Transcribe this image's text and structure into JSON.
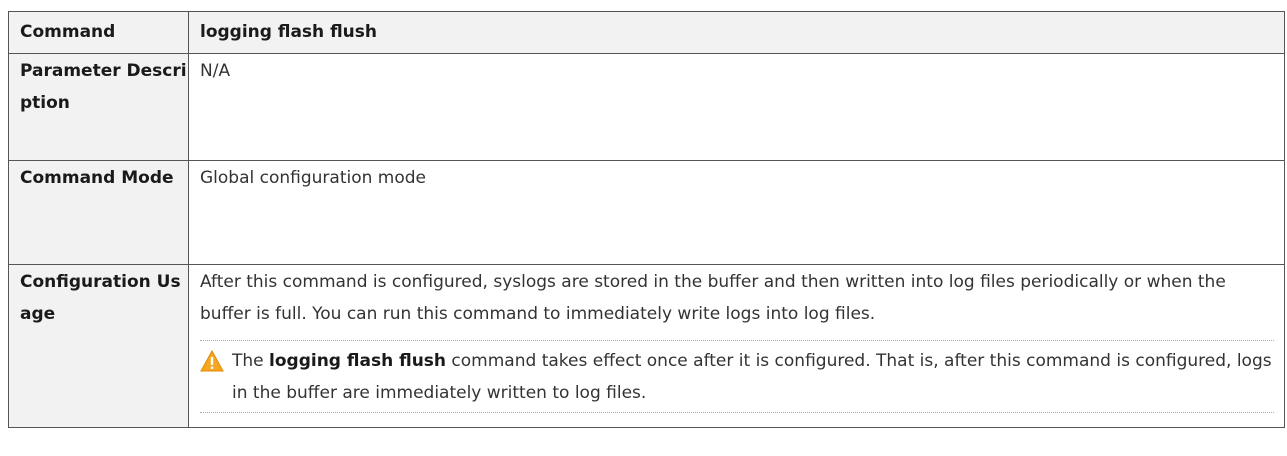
{
  "table": {
    "header": {
      "label": "Command",
      "value": "logging flash flush"
    },
    "parameter": {
      "label": "Parameter Description",
      "value": "N/A"
    },
    "mode": {
      "label": "Command Mode",
      "value": "Global configuration mode"
    },
    "usage": {
      "label": "Configuration Usage",
      "text": "After this command is configured, syslogs are stored in the buffer and then written into log files periodically or when the buffer is full. You can run this command to immediately write logs into log files.",
      "note": {
        "icon": "warning-icon",
        "prefix": "The ",
        "command": "logging flash flush",
        "suffix": " command takes effect once after it is configured. That is, after this command is configured, logs in the buffer are immediately written to log files."
      }
    }
  },
  "colors": {
    "label_background": "#f2f2f2",
    "border": "#555555",
    "warning": "#f5a623"
  }
}
